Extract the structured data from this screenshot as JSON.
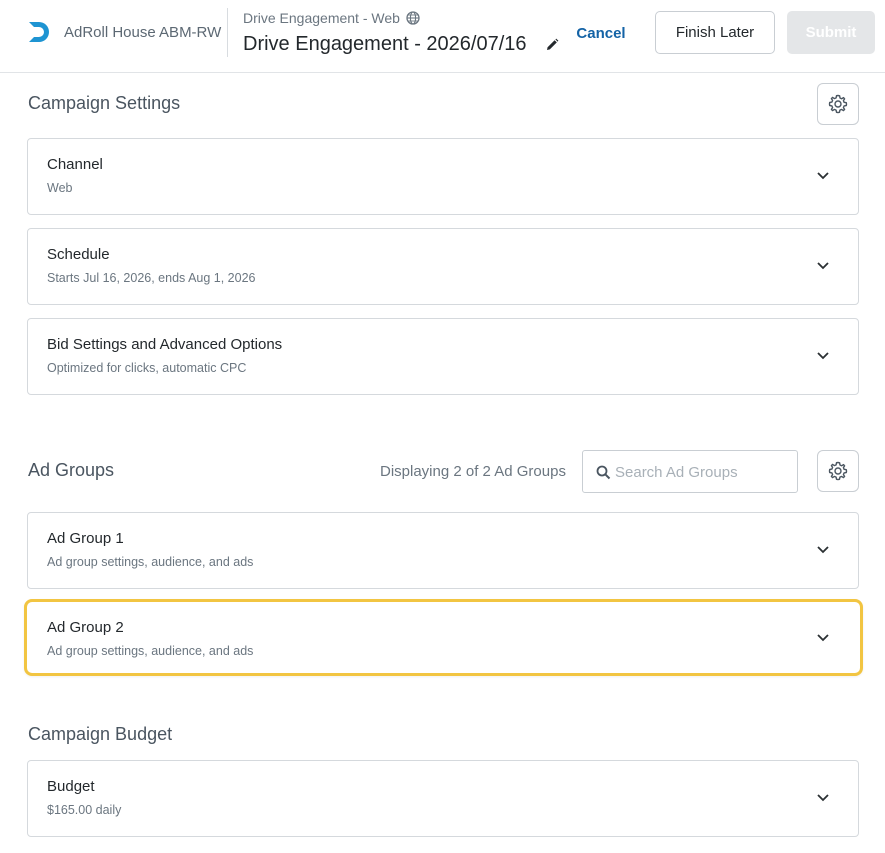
{
  "header": {
    "account_name": "AdRoll House ABM-RW",
    "campaign_type": "Drive Engagement - Web",
    "campaign_name": "Drive Engagement - 2026/07/16",
    "cancel_label": "Cancel",
    "finish_later_label": "Finish Later",
    "submit_label": "Submit"
  },
  "campaign_settings": {
    "title": "Campaign Settings",
    "cards": [
      {
        "title": "Channel",
        "subtitle": "Web"
      },
      {
        "title": "Schedule",
        "subtitle": "Starts Jul 16, 2026, ends Aug 1, 2026"
      },
      {
        "title": "Bid Settings and Advanced Options",
        "subtitle": "Optimized for clicks, automatic CPC"
      }
    ]
  },
  "ad_groups": {
    "title": "Ad Groups",
    "displaying": "Displaying 2 of 2 Ad Groups",
    "search_placeholder": "Search Ad Groups",
    "search_value": "",
    "cards": [
      {
        "title": "Ad Group 1",
        "subtitle": "Ad group settings, audience, and ads"
      },
      {
        "title": "Ad Group 2",
        "subtitle": "Ad group settings, audience, and ads"
      }
    ]
  },
  "budget": {
    "title": "Campaign Budget",
    "cards": [
      {
        "title": "Budget",
        "subtitle": "$165.00 daily"
      }
    ]
  },
  "colors": {
    "brand": "#1e94d2",
    "link": "#1463a6",
    "highlight": "#f2c542",
    "submit_disabled": "#e4e6e8"
  },
  "icons": [
    "logo-icon",
    "globe-icon",
    "pencil-icon",
    "gear-icon",
    "chevron-down-icon",
    "search-icon"
  ]
}
